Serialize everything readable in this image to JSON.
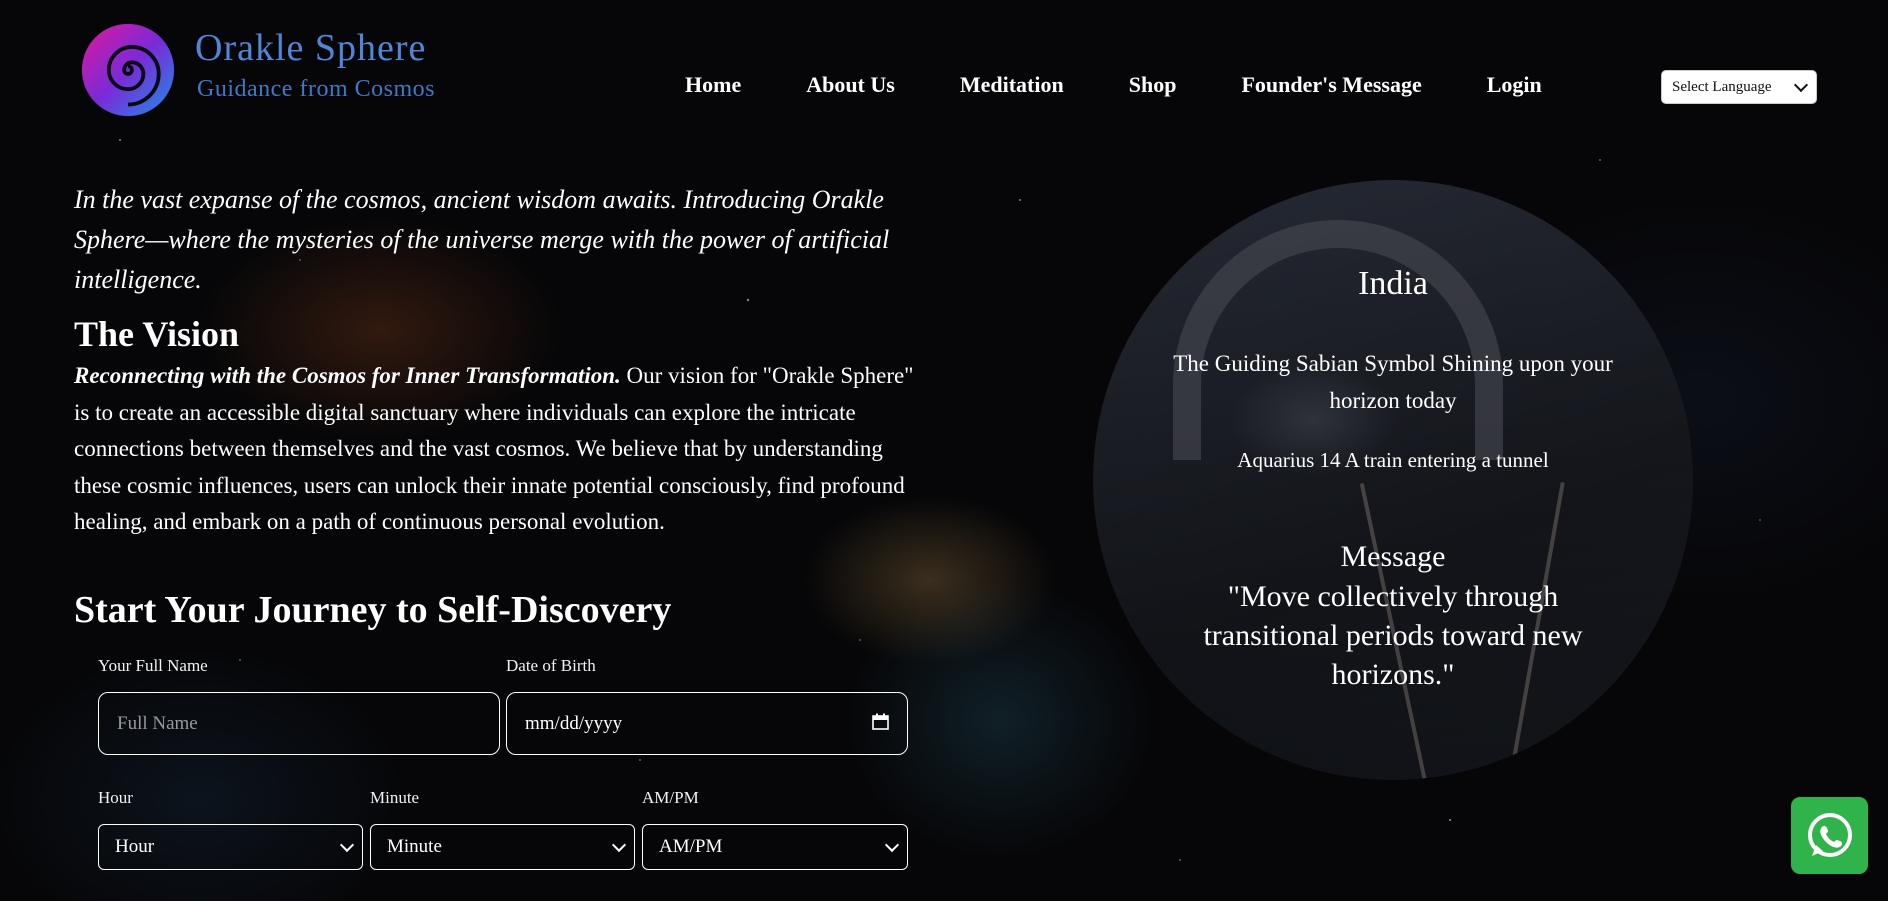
{
  "header": {
    "brand_title": "Orakle Sphere",
    "brand_subtitle": "Guidance from Cosmos",
    "logo_icon": "spiral-logo",
    "nav": [
      "Home",
      "About Us",
      "Meditation",
      "Shop",
      "Founder's Message",
      "Login"
    ],
    "language_select": "Select Language"
  },
  "intro": "In the vast expanse of the cosmos, ancient wisdom awaits. Introducing Orakle Sphere—where the mysteries of the universe merge with the power of artificial intelligence.",
  "vision": {
    "title": "The Vision",
    "lead": "Reconnecting with the Cosmos for Inner Transformation.",
    "text": " Our vision for \"Orakle Sphere\" is to create an accessible digital sanctuary where individuals can explore the intricate connections between themselves and the vast cosmos. We believe that by understanding these cosmic influences, users can unlock their innate potential consciously, find profound healing, and embark on a path of continuous personal evolution."
  },
  "form": {
    "title": "Start Your Journey to Self-Discovery",
    "name_label": "Your Full Name",
    "name_placeholder": "Full Name",
    "dob_label": "Date of Birth",
    "dob_placeholder": "mm/dd/yyyy",
    "hour_label": "Hour",
    "hour_value": "Hour",
    "minute_label": "Minute",
    "minute_value": "Minute",
    "ampm_label": "AM/PM",
    "ampm_value": "AM/PM"
  },
  "sabian": {
    "country": "India",
    "guiding_text": "The Guiding Sabian Symbol Shining upon your horizon today",
    "symbol": "Aquarius 14 A train entering a tunnel",
    "message_title": "Message",
    "message": "\"Move collectively through transitional periods toward new horizons.\""
  },
  "colors": {
    "brand_blue": "#4f86d8",
    "whatsapp_green": "#2fb34a"
  },
  "icons": {
    "calendar": "calendar-icon",
    "whatsapp": "whatsapp-icon"
  }
}
